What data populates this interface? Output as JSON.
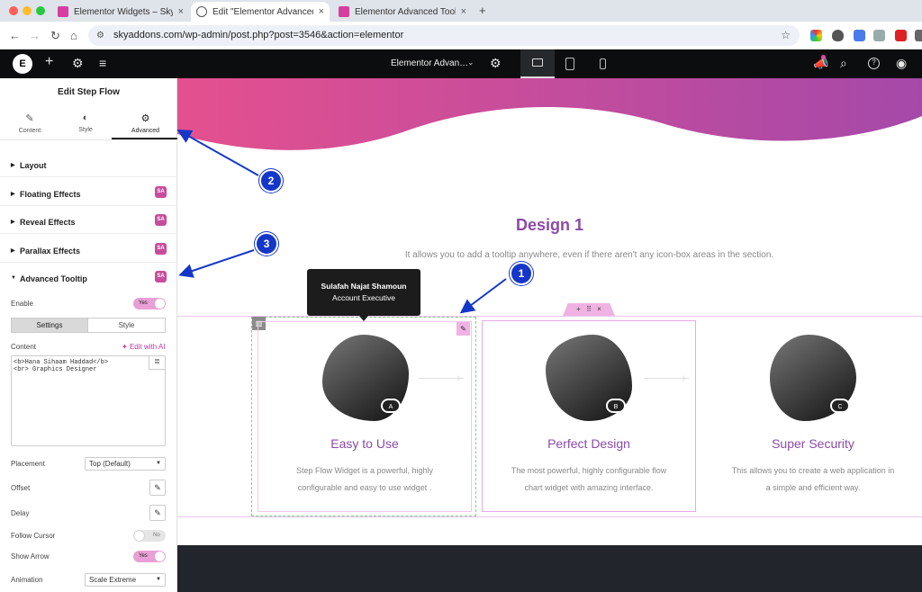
{
  "browser": {
    "tabs": [
      {
        "title": "Elementor Widgets – Sky Addons"
      },
      {
        "title": "Edit \"Elementor Advanced Tooltip\""
      },
      {
        "title": "Elementor Advanced Tooltip"
      }
    ],
    "url": "skyaddons.com/wp-admin/post.php?post=3546&action=elementor"
  },
  "topbar": {
    "page_name": "Elementor Advan…"
  },
  "panel": {
    "title": "Edit Step Flow",
    "tabs": [
      "Content",
      "Style",
      "Advanced"
    ],
    "sections": [
      "Layout",
      "Floating Effects",
      "Reveal Effects",
      "Parallax Effects",
      "Advanced Tooltip"
    ],
    "sky_badge": "SA",
    "enable_label": "Enable",
    "enable_value": "Yes",
    "subtabs": [
      "Settings",
      "Style"
    ],
    "content_label": "Content",
    "edit_ai": "Edit with AI",
    "content_line1": "<b>Hana Sihaam Haddad</b>",
    "content_line2": "<br> Graphics Designer",
    "placement_label": "Placement",
    "placement_value": "Top (Default)",
    "offset_label": "Offset",
    "delay_label": "Delay",
    "follow_cursor_label": "Follow Cursor",
    "follow_cursor_value": "No",
    "show_arrow_label": "Show Arrow",
    "show_arrow_value": "Yes",
    "animation_label": "Animation",
    "animation_value": "Scale Extreme"
  },
  "canvas": {
    "heading": "Design 1",
    "subheading": "It allows you to add a tooltip anywhere, even if there aren't any icon-box areas in the section.",
    "tooltip": {
      "name": "Sulafah Najat Shamoun",
      "role": "Account Executive"
    },
    "cards": [
      {
        "badge": "A",
        "title": "Easy to Use",
        "desc1": "Step Flow Widget is a powerful, highly",
        "desc2": "configurable and easy to use widget ."
      },
      {
        "badge": "B",
        "title": "Perfect Design",
        "desc1": "The most powerful, highly configurable flow",
        "desc2": "chart widget with amazing interface."
      },
      {
        "badge": "C",
        "title": "Super Security",
        "desc1": "This allows you to create a web application in",
        "desc2": "a simple and efficient way."
      }
    ]
  },
  "callouts": [
    "1",
    "2",
    "3"
  ],
  "colors": {
    "accent": "#8b4aa8",
    "pink": "#e44d8f",
    "callout": "#1537c9",
    "toggle": "#e8a0d6"
  }
}
